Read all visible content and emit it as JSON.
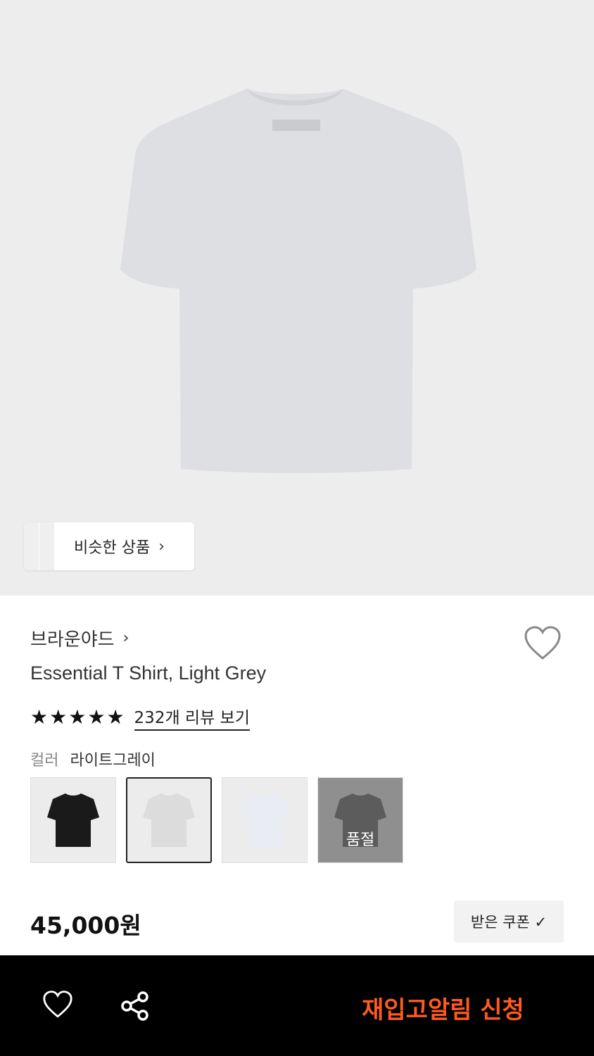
{
  "hero": {
    "image_alt": "light-grey-tshirt",
    "similar_label": "비슷한 상품",
    "similar_chevron": "›"
  },
  "product": {
    "brand": "브라운야드",
    "brand_chevron": "›",
    "title": "Essential T Shirt, Light Grey",
    "rating_stars": 5,
    "review_link": "232개 리뷰 보기",
    "color_key": "컬러",
    "color_value": "라이트그레이",
    "swatches": [
      {
        "name": "black",
        "color": "#1a1a1a",
        "selected": false,
        "sold_out": false
      },
      {
        "name": "light-grey",
        "color": "#dcdcdc",
        "selected": true,
        "sold_out": false
      },
      {
        "name": "white",
        "color": "#e8ebf0",
        "selected": false,
        "sold_out": false
      },
      {
        "name": "charcoal",
        "color": "#5c5c5c",
        "selected": false,
        "sold_out": true,
        "sold_out_label": "품절"
      }
    ],
    "price": "45,000원",
    "coupon_label": "받은 쿠폰 ✓"
  },
  "bottom_bar": {
    "restock_label": "재입고알림 신청",
    "accent_color": "#ff5a1f"
  }
}
